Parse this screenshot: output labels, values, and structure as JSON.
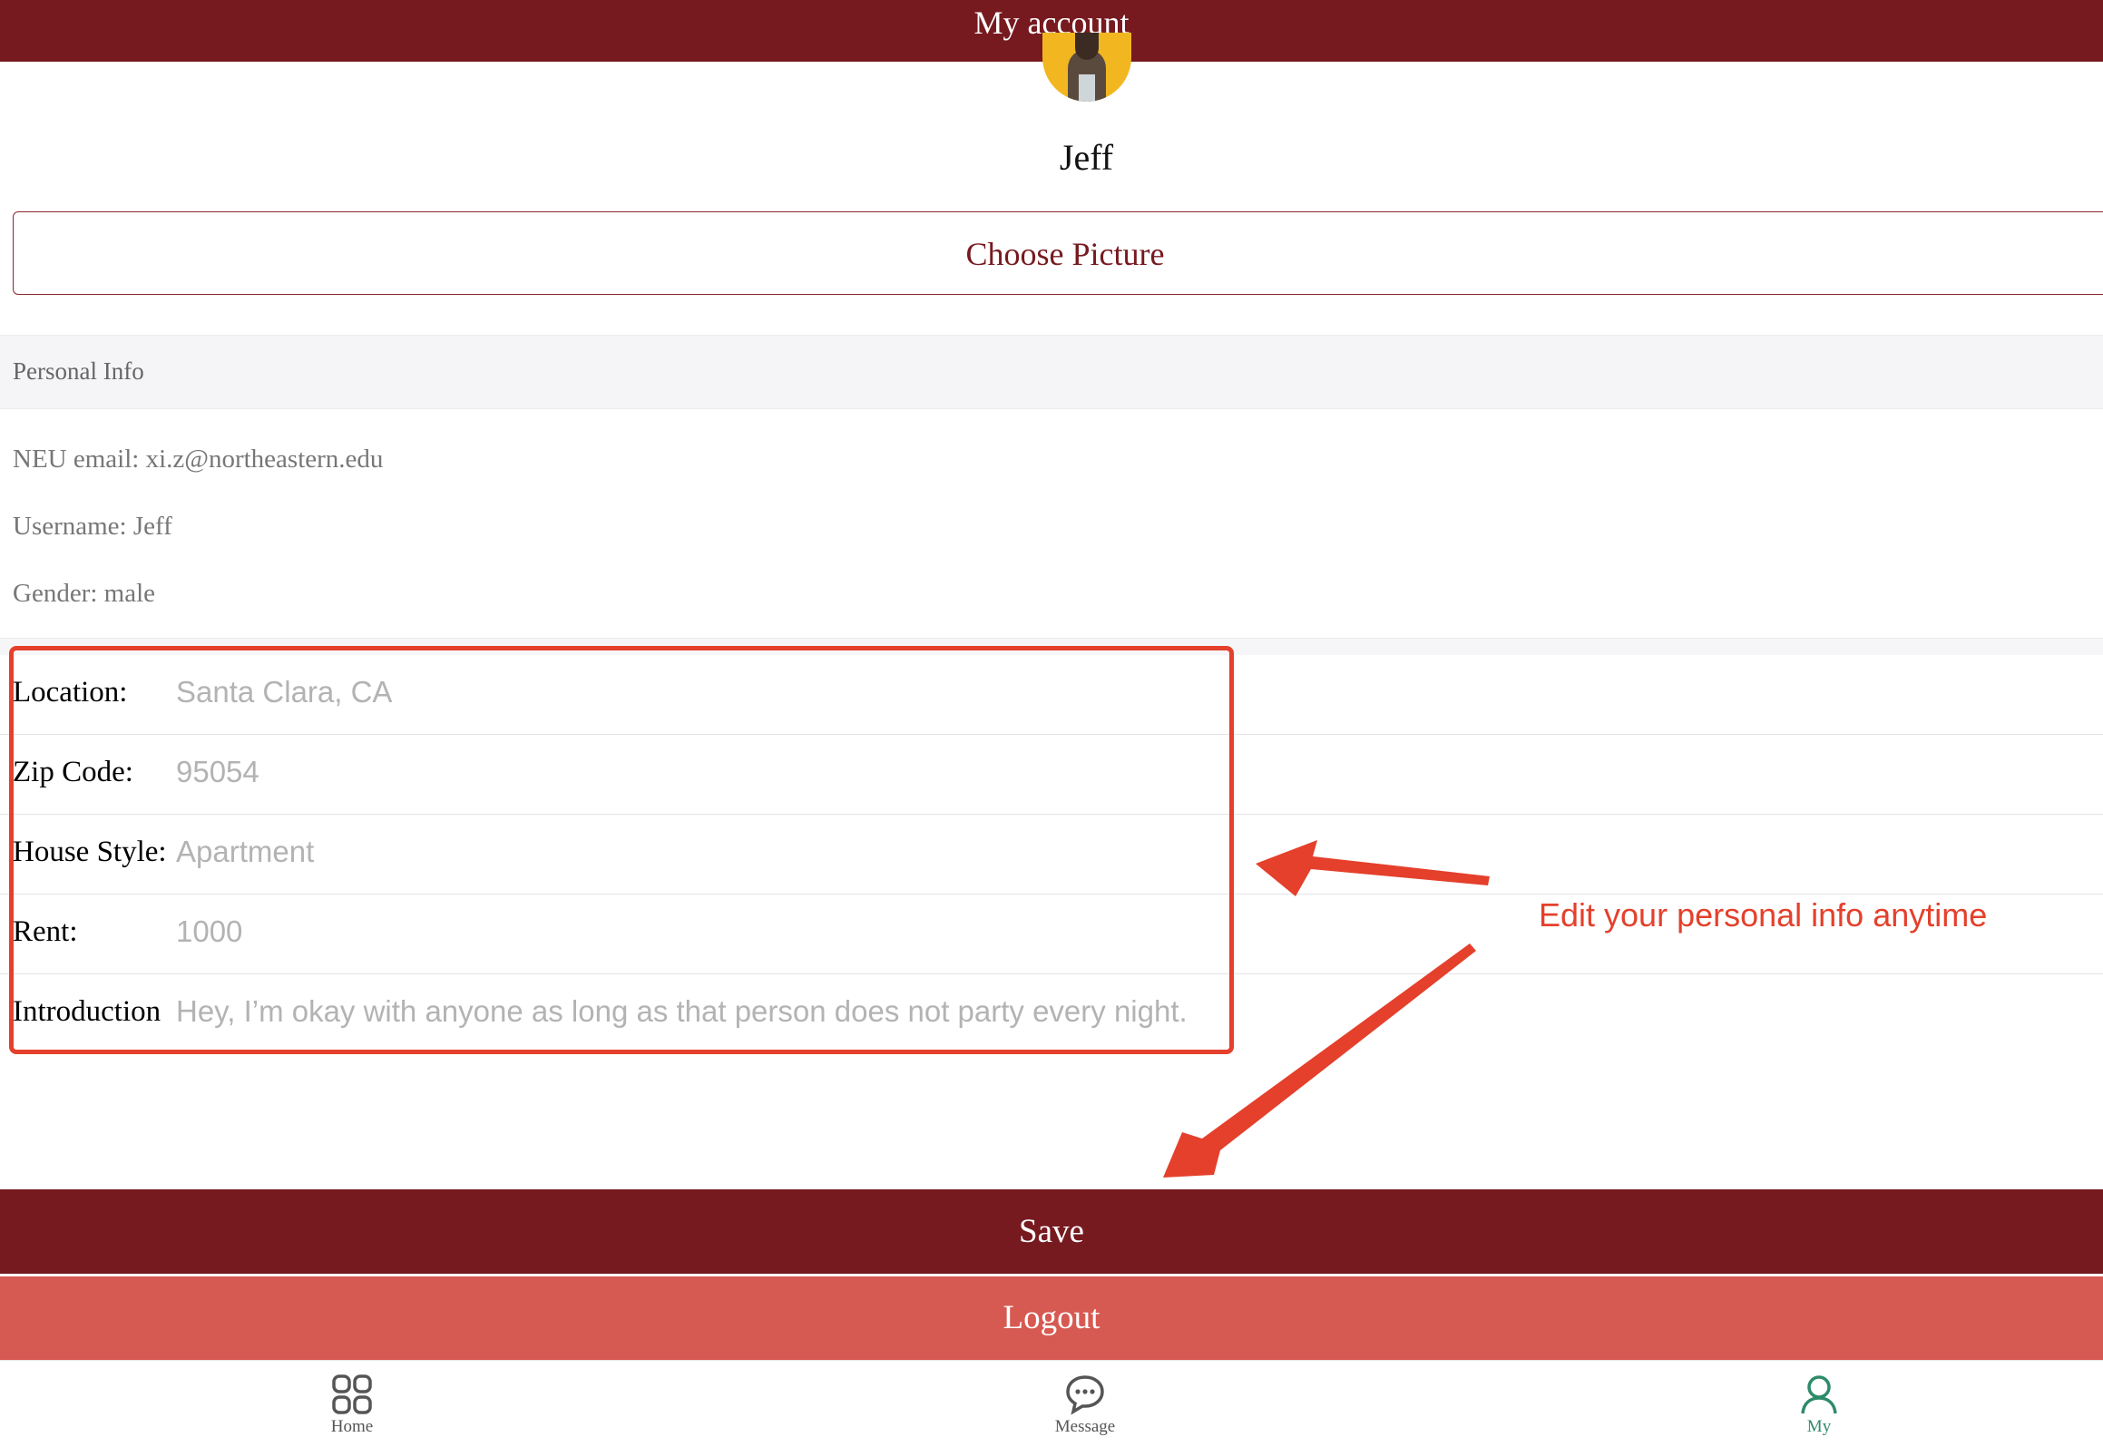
{
  "header": {
    "title": "My account"
  },
  "profile": {
    "name": "Jeff",
    "choose_picture_label": "Choose Picture"
  },
  "personal_info": {
    "section_title": "Personal Info",
    "email": "NEU email: xi.z@northeastern.edu",
    "username": "Username: Jeff",
    "gender": "Gender: male"
  },
  "form": {
    "location": {
      "label": "Location:",
      "value": "Santa Clara, CA"
    },
    "zip": {
      "label": "Zip Code:",
      "value": "95054"
    },
    "house_style": {
      "label": "House Style:",
      "value": "Apartment"
    },
    "rent": {
      "label": "Rent:",
      "value": "1000"
    },
    "introduction": {
      "label": "Introduction",
      "value": "Hey, I’m okay with anyone as long as that person does not party every night."
    }
  },
  "annotation": {
    "text": "Edit your personal info anytime",
    "color": "#e4402c"
  },
  "actions": {
    "save_label": "Save",
    "logout_label": "Logout"
  },
  "tabbar": {
    "items": [
      {
        "label": "Home",
        "icon": "grid-icon",
        "active": false
      },
      {
        "label": "Message",
        "icon": "chat-bubble-icon",
        "active": false
      },
      {
        "label": "My",
        "icon": "person-icon",
        "active": true
      }
    ]
  },
  "colors": {
    "brand": "#761a1f",
    "logout": "#d75a52",
    "active_tab": "#2e8b6a"
  }
}
